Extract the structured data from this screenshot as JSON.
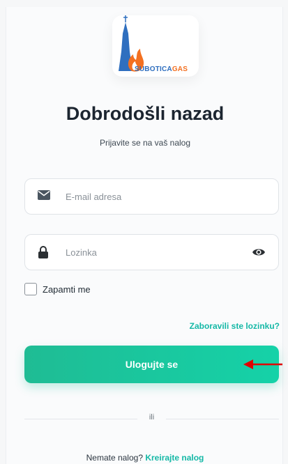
{
  "logo": {
    "brand_primary": "SUBOTICA",
    "brand_accent": "GAS",
    "colors": {
      "primary": "#2f6fbf",
      "accent": "#f37021"
    }
  },
  "header": {
    "title": "Dobrodošli nazad",
    "subtitle": "Prijavite se na vaš nalog"
  },
  "form": {
    "email": {
      "placeholder": "E-mail adresa",
      "value": "",
      "icon": "envelope-icon"
    },
    "password": {
      "placeholder": "Lozinka",
      "value": "",
      "icon": "lock-icon",
      "toggle_icon": "eye-icon"
    },
    "remember_label": "Zapamti me",
    "forgot_link": "Zaboravili ste lozinku?",
    "submit_label": "Ulogujte se"
  },
  "divider": {
    "label": "ili"
  },
  "footer": {
    "prompt": "Nemate nalog?",
    "signup_link": "Kreirajte nalog"
  },
  "theme": {
    "accent": "#14b8a6",
    "button_gradient": [
      "#1fbc94",
      "#15d2a8"
    ],
    "annotation_arrow": "#e00000"
  }
}
